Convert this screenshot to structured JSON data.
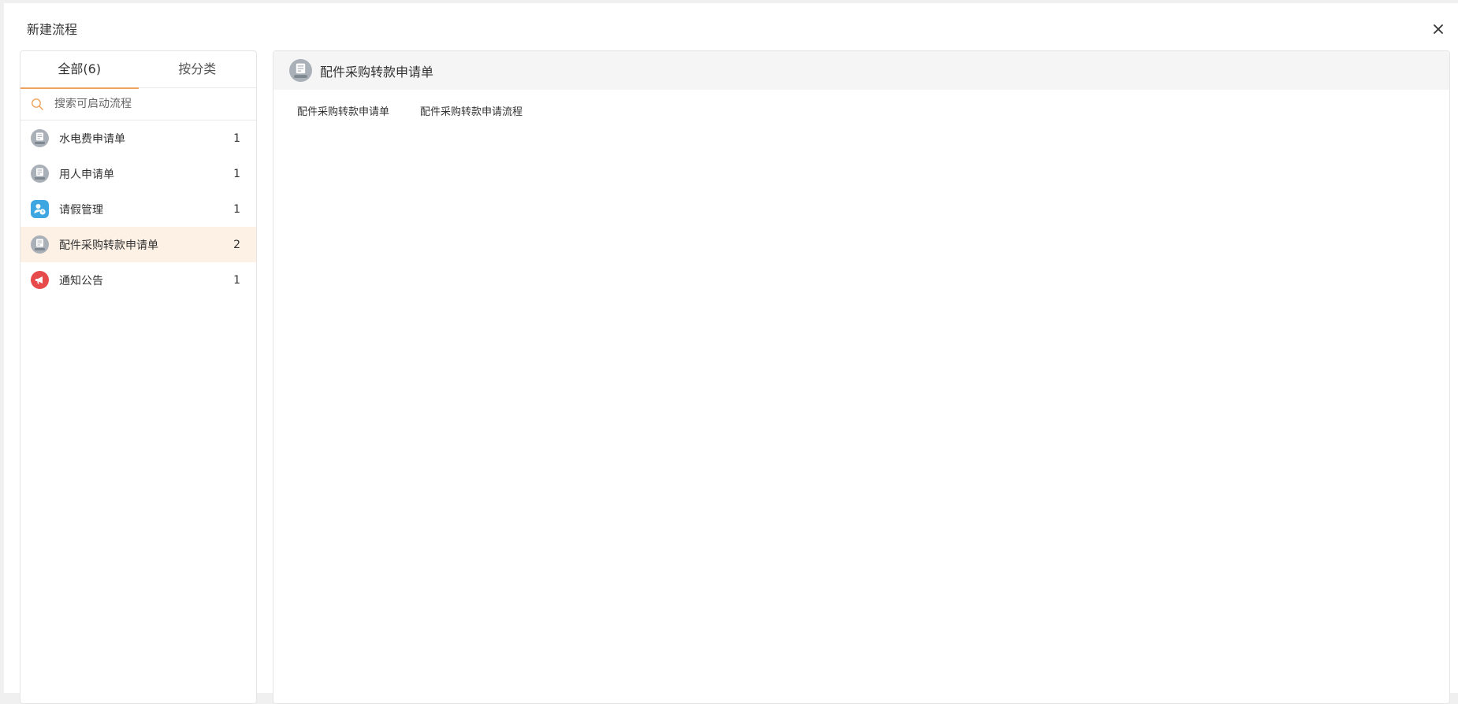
{
  "dialog": {
    "title": "新建流程"
  },
  "tabs": [
    {
      "label": "全部(6)"
    },
    {
      "label": "按分类"
    }
  ],
  "search": {
    "placeholder": "搜索可启动流程"
  },
  "flows": [
    {
      "name": "水电费申请单",
      "count": "1",
      "icon": "form-icon"
    },
    {
      "name": "用人申请单",
      "count": "1",
      "icon": "form-icon"
    },
    {
      "name": "请假管理",
      "count": "1",
      "icon": "person-clock-icon"
    },
    {
      "name": "配件采购转款申请单",
      "count": "2",
      "icon": "form-icon"
    },
    {
      "name": "通知公告",
      "count": "1",
      "icon": "megaphone-icon"
    }
  ],
  "selected": {
    "title": "配件采购转款申请单",
    "templates": [
      {
        "label": "配件采购转款申请单"
      },
      {
        "label": "配件采购转款申请流程"
      }
    ]
  },
  "colors": {
    "accent": "#f0a35c",
    "selected_bg": "#fdf1e6",
    "form_icon": "#a9b0b8",
    "leave_icon": "#3ea6e0",
    "notice_icon": "#e64a4a"
  }
}
